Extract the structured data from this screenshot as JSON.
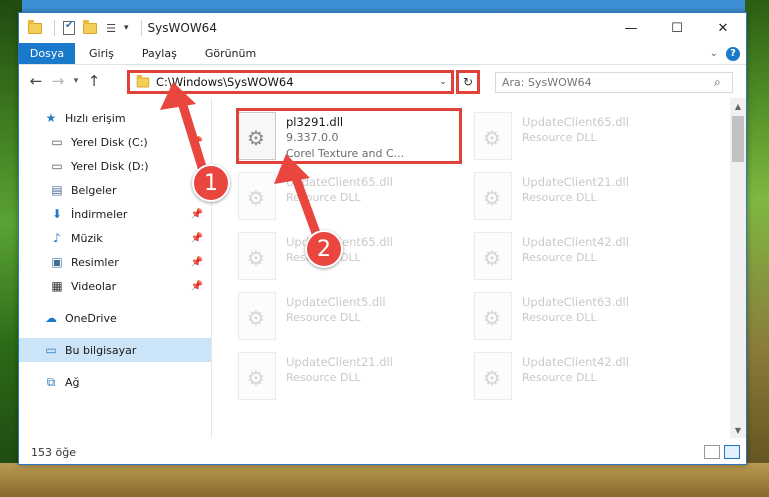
{
  "window": {
    "title": "SysWOW64"
  },
  "ribbon": {
    "file_tab": "Dosya",
    "tabs": [
      "Giriş",
      "Paylaş",
      "Görünüm"
    ]
  },
  "nav": {
    "address": "C:\\Windows\\SysWOW64",
    "search_placeholder": "Ara: SysWOW64"
  },
  "sidebar": {
    "items": [
      {
        "label": "Hızlı erişim",
        "icon": "star-icon",
        "level": 0,
        "pinned": false
      },
      {
        "label": "Yerel Disk (C:)",
        "icon": "drive-icon",
        "level": 1,
        "pinned": true
      },
      {
        "label": "Yerel Disk (D:)",
        "icon": "drive-icon",
        "level": 1,
        "pinned": true
      },
      {
        "label": "Belgeler",
        "icon": "documents-icon",
        "level": 1,
        "pinned": true
      },
      {
        "label": "İndirmeler",
        "icon": "download-icon",
        "level": 1,
        "pinned": true
      },
      {
        "label": "Müzik",
        "icon": "music-icon",
        "level": 1,
        "pinned": true
      },
      {
        "label": "Resimler",
        "icon": "pictures-icon",
        "level": 1,
        "pinned": true
      },
      {
        "label": "Videolar",
        "icon": "video-icon",
        "level": 1,
        "pinned": true
      },
      {
        "label": "OneDrive",
        "icon": "cloud-icon",
        "level": 0,
        "pinned": false
      },
      {
        "label": "Bu bilgisayar",
        "icon": "computer-icon",
        "level": 0,
        "pinned": false,
        "selected": true
      },
      {
        "label": "Ağ",
        "icon": "network-icon",
        "level": 0,
        "pinned": false
      }
    ]
  },
  "files": [
    {
      "name": "pl3291.dll",
      "line2": "9.337.0.0",
      "line3": "Corel Texture and C...",
      "highlighted": true
    },
    {
      "name": "UpdateClient65.dll",
      "line2": "Resource DLL"
    },
    {
      "name": "UpdateClient65.dll",
      "line2": "Resource DLL"
    },
    {
      "name": "UpdateClient21.dll",
      "line2": "Resource DLL"
    },
    {
      "name": "UpdateClient65.dll",
      "line2": "Resource DLL"
    },
    {
      "name": "UpdateClient42.dll",
      "line2": "Resource DLL"
    },
    {
      "name": "UpdateClient5.dll",
      "line2": "Resource DLL"
    },
    {
      "name": "UpdateClient63.dll",
      "line2": "Resource DLL"
    },
    {
      "name": "UpdateClient21.dll",
      "line2": "Resource DLL"
    },
    {
      "name": "UpdateClient42.dll",
      "line2": "Resource DLL"
    }
  ],
  "status": {
    "count": "153 öğe"
  },
  "annotations": {
    "badge1": "1",
    "badge2": "2"
  },
  "colors": {
    "accent": "#1979ca",
    "annotation": "#e8463f"
  }
}
